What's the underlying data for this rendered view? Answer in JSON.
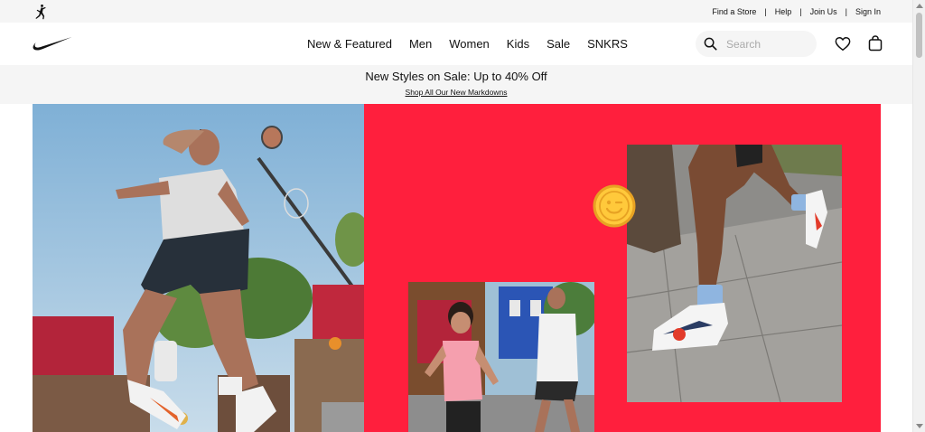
{
  "utility_bar": {
    "links": [
      "Find a Store",
      "Help",
      "Join Us",
      "Sign In"
    ],
    "separator": "|"
  },
  "nav": {
    "items": [
      "New & Featured",
      "Men",
      "Women",
      "Kids",
      "Sale",
      "SNKRS"
    ]
  },
  "search": {
    "placeholder": "Search",
    "value": ""
  },
  "promo": {
    "title": "New Styles on Sale: Up to 40% Off",
    "link": "Shop All Our New Markdowns"
  },
  "colors": {
    "hero_red": "#ff1f3d",
    "utility_bg": "#f5f5f5",
    "smiley": "#ffc93b"
  },
  "icons": [
    "jordan-jumpman-icon",
    "nike-swoosh-icon",
    "search-icon",
    "heart-icon",
    "bag-icon",
    "smiley-wink-icon"
  ]
}
